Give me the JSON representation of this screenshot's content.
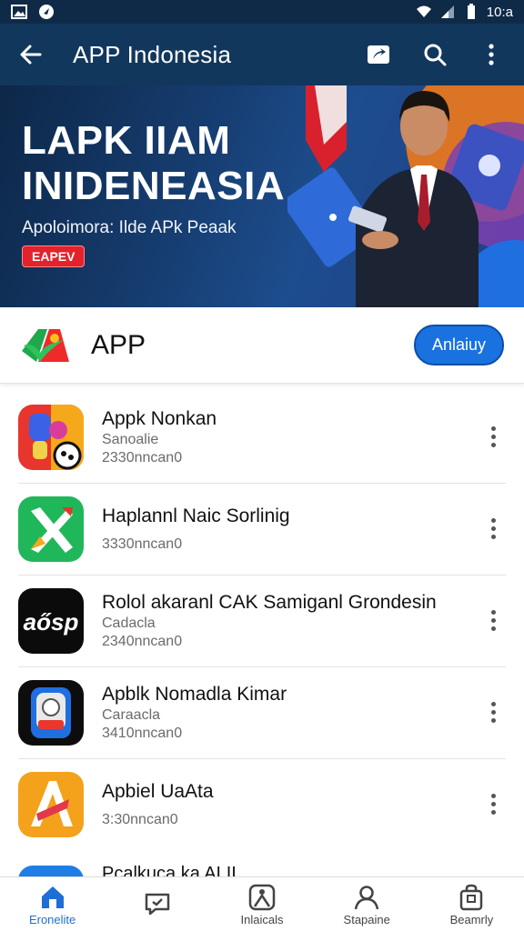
{
  "status_bar": {
    "time": "10:a"
  },
  "app_bar": {
    "title": "APP Indonesia",
    "icons": [
      "back-arrow-icon",
      "share-icon",
      "search-icon",
      "more-vertical-icon"
    ]
  },
  "banner": {
    "headline_line1": "LAPK IIAM",
    "headline_line2": "INIDENEASIA",
    "subtitle": "Apoloimora: Ilde APk Peaak",
    "badge": "EAPEV"
  },
  "app_header": {
    "name": "APP",
    "button_label": "Anlaiuy",
    "accent": "#1a72e0"
  },
  "apps": [
    {
      "title": "Appk Nonkan",
      "subtitle": "Sanoalie",
      "meta": "2330nncan0"
    },
    {
      "title": "Haplannl Naic Sorlinig",
      "subtitle": "",
      "meta": "3330nncan0"
    },
    {
      "title": "Rolol akaranl CAK Samiganl Grondesin",
      "subtitle": "Cadacla",
      "meta": "2340nncan0"
    },
    {
      "title": "Apblk Nomadla Kimar",
      "subtitle": "Caraacla",
      "meta": "3410nncan0"
    },
    {
      "title": "Apbiel UaAta",
      "subtitle": "",
      "meta": "3:30nncan0"
    }
  ],
  "peek_item": {
    "title": "Pcalkuca ka ALII"
  },
  "bottom_nav": [
    {
      "label": "Eronelite",
      "icon": "home-icon",
      "active": true
    },
    {
      "label": "",
      "icon": "chat-icon",
      "active": false
    },
    {
      "label": "Inlaicals",
      "icon": "person-stand-icon",
      "active": false
    },
    {
      "label": "Stapaine",
      "icon": "profile-icon",
      "active": false
    },
    {
      "label": "Beamrly",
      "icon": "bag-icon",
      "active": false
    }
  ]
}
